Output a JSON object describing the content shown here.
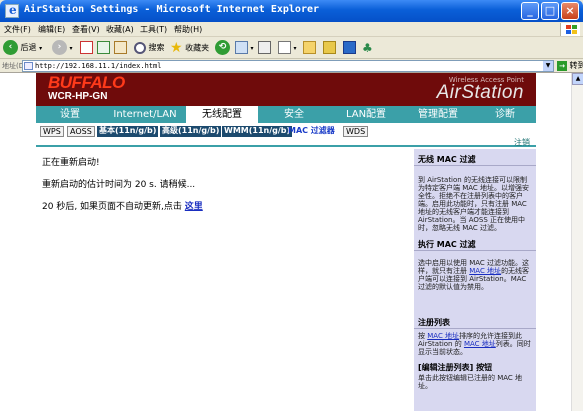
{
  "window": {
    "title": "AirStation Settings - Microsoft Internet Explorer",
    "minimize": "_",
    "maximize": "□",
    "close": "×"
  },
  "menu": {
    "items": [
      "文件(F)",
      "编辑(E)",
      "查看(V)",
      "收藏(A)",
      "工具(T)",
      "帮助(H)"
    ]
  },
  "toolbar": {
    "back_label": "后退",
    "search_label": "搜索",
    "favorites_label": "收藏夹"
  },
  "address": {
    "label": "地址(D)",
    "url": "http://192.168.11.1/index.html",
    "go_label": "转到"
  },
  "header": {
    "brand": "BUFFALO",
    "model": "WCR-HP-GN",
    "product_line": "Wireless Access Point",
    "product_name": "AirStation"
  },
  "nav": {
    "tabs": [
      "设置",
      "Internet/LAN",
      "无线配置",
      "安全",
      "LAN配置",
      "管理配置",
      "诊断"
    ],
    "active": "无线配置"
  },
  "subnav": {
    "items": [
      "WPS",
      "AOSS",
      "基本(11n/g/b)",
      "高级(11n/g/b)",
      "WMM(11n/g/b)",
      "MAC 过滤器",
      "WDS"
    ],
    "logout": "注销"
  },
  "main": {
    "restarting": "正在重新启动!",
    "estimate": "重新启动的估计时间为  20 s. 请稍候...",
    "redirect_prefix": "20 秒后, 如果页面不自动更新,点击 ",
    "redirect_link": "这里"
  },
  "help": {
    "section1_title": "无线 MAC 过滤",
    "section1_text": "到 AirStation 的无线连接可以限制为特定客户端 MAC 地址。以增强安全性。拒绝不在注册列表中的客户端。启用此功能时，只有注册 MAC 地址的无线客户端才能连接到 AirStation。当 AOSS 正在使用中时，忽略无线 MAC 过滤。",
    "section2_title": "执行 MAC 过滤",
    "section2_text_a": "选中启用以使用 MAC 过滤功能。这样，就只有注册 ",
    "section2_link": "MAC 地址",
    "section2_text_b": "的无线客户端可以连接到 AirStation。MAC 过滤的默认值为禁用。",
    "section3_title": "注册列表",
    "section3_text_a": "按 ",
    "section3_link_a": "MAC 地址",
    "section3_text_b": "排序的允许连接到此 AirStation 的 ",
    "section3_link_b": "MAC 地址",
    "section3_text_c": "列表。同时显示当前状态。",
    "section4_title": "[编辑注册列表] 按钮",
    "section4_text": "单击此按钮编辑已注册的 MAC 地址。"
  },
  "colors": {
    "header_bg": "#6f0b0b",
    "brand": "#ff3a1a",
    "nav_bg": "#3ba0a8",
    "help_bg": "#d8d8f0",
    "link": "#1a2ec0"
  }
}
